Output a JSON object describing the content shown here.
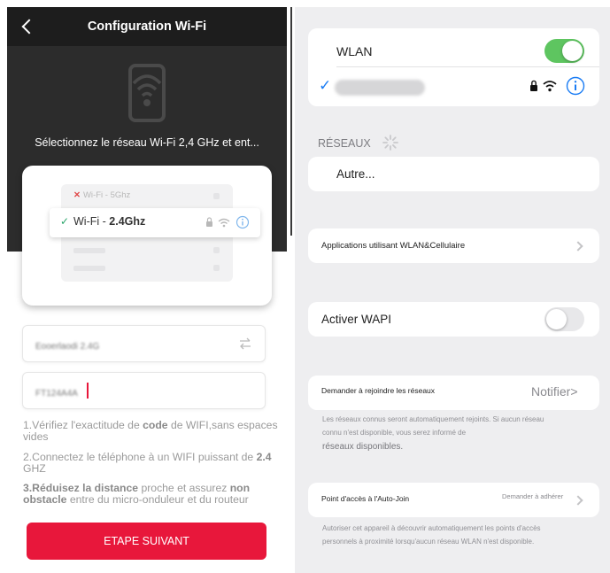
{
  "colors": {
    "accent_red": "#e8173b",
    "ios_blue": "#1a7cf4",
    "ios_green": "#5ec560",
    "dark_header": "#2c2c2c"
  },
  "left": {
    "title": "Configuration Wi-Fi",
    "back_icon": "chevron-left-icon",
    "router_icon": "wifi-router-icon",
    "subtitle": "Sélectionnez le réseau Wi-Fi 2,4 GHz et ent...",
    "illustration": {
      "wifi5_label": "Wi-Fi - 5Ghz",
      "selected_prefix": "Wi-Fi - ",
      "selected_bold": "2.4Ghz"
    },
    "ssid_field_value": "Eooerlaodi 2.4G",
    "password_field_value": "FT124A4A",
    "instructions": [
      {
        "num": "1.",
        "a": "Vérifiez l'exactitude de ",
        "b": "code",
        "c": " de WIFI,sans espaces vides"
      },
      {
        "num": "2.",
        "a": "Connectez le téléphone à un WIFI puissant de ",
        "b": "2.4",
        "c": " GHZ"
      },
      {
        "num": "3.",
        "b1": "Réduisez la distance",
        "a": " proche et assurez ",
        "b2": "non obstacle",
        "c": " entre du micro-onduleur et du routeur"
      }
    ],
    "next_button": "ETAPE SUIVANT"
  },
  "right": {
    "wlan_label": "WLAN",
    "wlan_enabled": true,
    "networks_header": "RÉSEAUX",
    "other_label": "Autre...",
    "apps_label": "Applications utilisant WLAN&Cellulaire",
    "wapi_label": "Activer WAPI",
    "wapi_enabled": false,
    "ask_join_label": "Demander à rejoindre les réseaux",
    "ask_join_value": "Notifier>",
    "ask_join_note_1": "Les réseaux connus seront automatiquement rejoints. Si aucun réseau",
    "ask_join_note_2": "connu n'est disponible, vous serez informé de",
    "ask_join_note_3": "réseaux disponibles.",
    "autojoin_label": "Point d'accès à l'Auto-Join",
    "autojoin_value": "Demander à adhérer",
    "autojoin_note_1": "Autoriser cet appareil à découvrir automatiquement les points d'accès",
    "autojoin_note_2": "personnels à proximité lorsqu'aucun réseau WLAN n'est disponible."
  }
}
